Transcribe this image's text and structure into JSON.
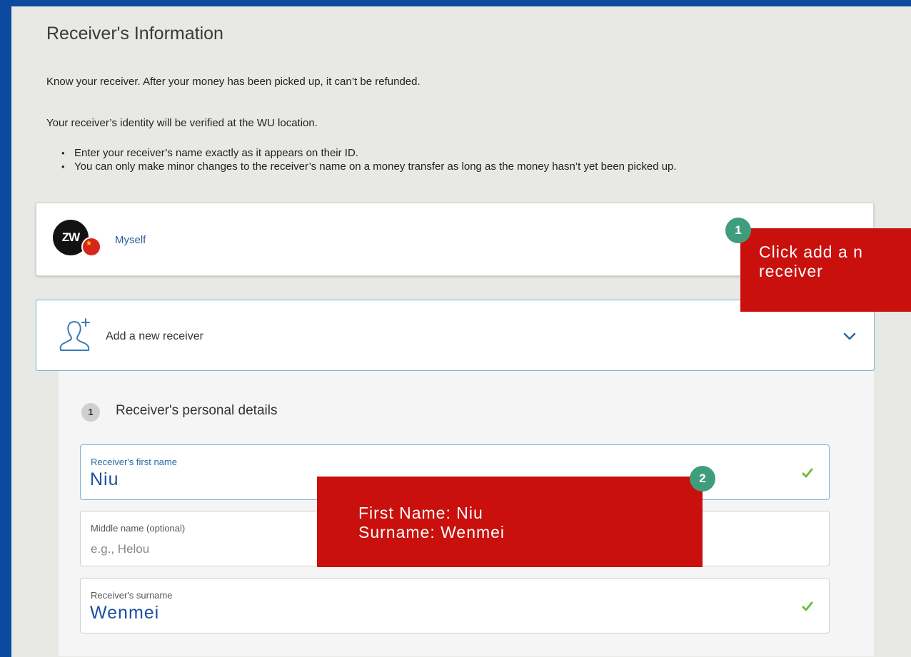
{
  "page": {
    "title": "Receiver's Information",
    "intro_1": "Know your receiver. After your money has been picked up, it can’t be refunded.",
    "intro_2": "Your receiver’s identity will be verified at the WU location.",
    "bullets": [
      "Enter your receiver’s name exactly as it appears on their ID.",
      "You can only make minor changes to the receiver’s name on a money transfer as long as the money hasn’t yet been picked up."
    ]
  },
  "myself_card": {
    "avatar_initials": "ZW",
    "label": "Myself"
  },
  "add_receiver": {
    "label": "Add a new receiver"
  },
  "form": {
    "step_number": "1",
    "step_title": "Receiver's personal details",
    "first_name": {
      "label": "Receiver's first name",
      "value": "Niu"
    },
    "middle_name": {
      "label": "Middle name (optional)",
      "placeholder": "e.g., Helou"
    },
    "surname": {
      "label": "Receiver's surname",
      "value": "Wenmei"
    }
  },
  "annotations": {
    "badge_1": "1",
    "callout_1_line_1": "Click add a n",
    "callout_1_line_2": "receiver",
    "badge_2": "2",
    "callout_2_line_1": "First Name: Niu",
    "callout_2_line_2": "Surname: Wenmei"
  },
  "colors": {
    "frame": "#0b4a9e",
    "callout": "#c9100c",
    "badge": "#3f9d7c",
    "value_text": "#1e4fa0",
    "check": "#6cbf3a"
  }
}
